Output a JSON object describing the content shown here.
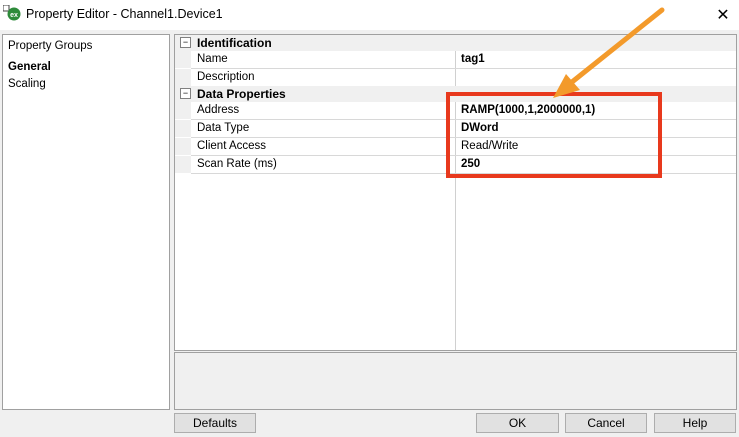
{
  "window": {
    "title": "Property Editor - Channel1.Device1",
    "close_glyph": "✕"
  },
  "groups": {
    "header": "Property Groups",
    "items": [
      {
        "label": "General"
      },
      {
        "label": "Scaling"
      }
    ]
  },
  "grid": {
    "categories": [
      {
        "label": "Identification",
        "toggle": "⊟",
        "properties": [
          {
            "name": "Name",
            "value": "tag1"
          },
          {
            "name": "Description",
            "value": ""
          }
        ]
      },
      {
        "label": "Data Properties",
        "toggle": "⊟",
        "properties": [
          {
            "name": "Address",
            "value": "RAMP(1000,1,2000000,1)"
          },
          {
            "name": "Data Type",
            "value": "DWord"
          },
          {
            "name": "Client Access",
            "value": "Read/Write"
          },
          {
            "name": "Scan Rate (ms)",
            "value": "250"
          }
        ]
      }
    ]
  },
  "buttons": {
    "defaults": "Defaults",
    "ok": "OK",
    "cancel": "Cancel",
    "help": "Help"
  },
  "annotation": {
    "highlight_color": "#e8391d",
    "arrow_color": "#f39a2b"
  },
  "icons": {
    "app": "kepware-ex-icon",
    "close": "close-icon"
  }
}
